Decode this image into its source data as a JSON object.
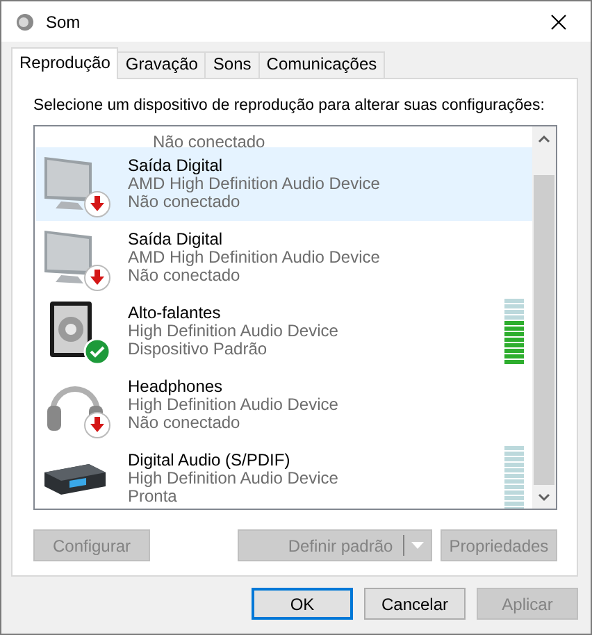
{
  "window": {
    "title": "Som"
  },
  "tabs": [
    {
      "label": "Reprodução",
      "selected": true
    },
    {
      "label": "Gravação",
      "selected": false
    },
    {
      "label": "Sons",
      "selected": false
    },
    {
      "label": "Comunicações",
      "selected": false
    }
  ],
  "instruction": "Selecione um dispositivo de reprodução para alterar suas configurações:",
  "devices": [
    {
      "kind": "partial",
      "status": "Não conectado",
      "selected": false
    },
    {
      "kind": "monitor",
      "badge": {
        "kind": "disconnected"
      },
      "name": "Saída Digital",
      "driver": "AMD High Definition Audio Device",
      "status": "Não conectado",
      "selected": true
    },
    {
      "kind": "monitor",
      "badge": {
        "kind": "disconnected"
      },
      "name": "Saída Digital",
      "driver": "AMD High Definition Audio Device",
      "status": "Não conectado",
      "selected": false
    },
    {
      "kind": "speaker",
      "badge": {
        "kind": "default"
      },
      "name": "Alto-falantes",
      "driver": "High Definition Audio Device",
      "status": "Dispositivo Padrão",
      "selected": false,
      "level": 0.65
    },
    {
      "kind": "headphones",
      "badge": {
        "kind": "disconnected"
      },
      "name": "Headphones",
      "driver": "High Definition Audio Device",
      "status": "Não conectado",
      "selected": false
    },
    {
      "kind": "receiver",
      "name": "Digital Audio (S/PDIF)",
      "driver": "High Definition Audio Device",
      "status": "Pronta",
      "selected": false,
      "level": 0
    }
  ],
  "panel_buttons": [
    {
      "label": "Configurar",
      "disabled": true,
      "split": false
    },
    {
      "label": "Definir padrão",
      "disabled": true,
      "split": true
    },
    {
      "label": "Propriedades",
      "disabled": true,
      "split": false
    }
  ],
  "dialog_buttons": [
    {
      "label": "OK",
      "disabled": false,
      "focused": true
    },
    {
      "label": "Cancelar",
      "disabled": false,
      "focused": false
    },
    {
      "label": "Aplicar",
      "disabled": true,
      "focused": false
    }
  ]
}
